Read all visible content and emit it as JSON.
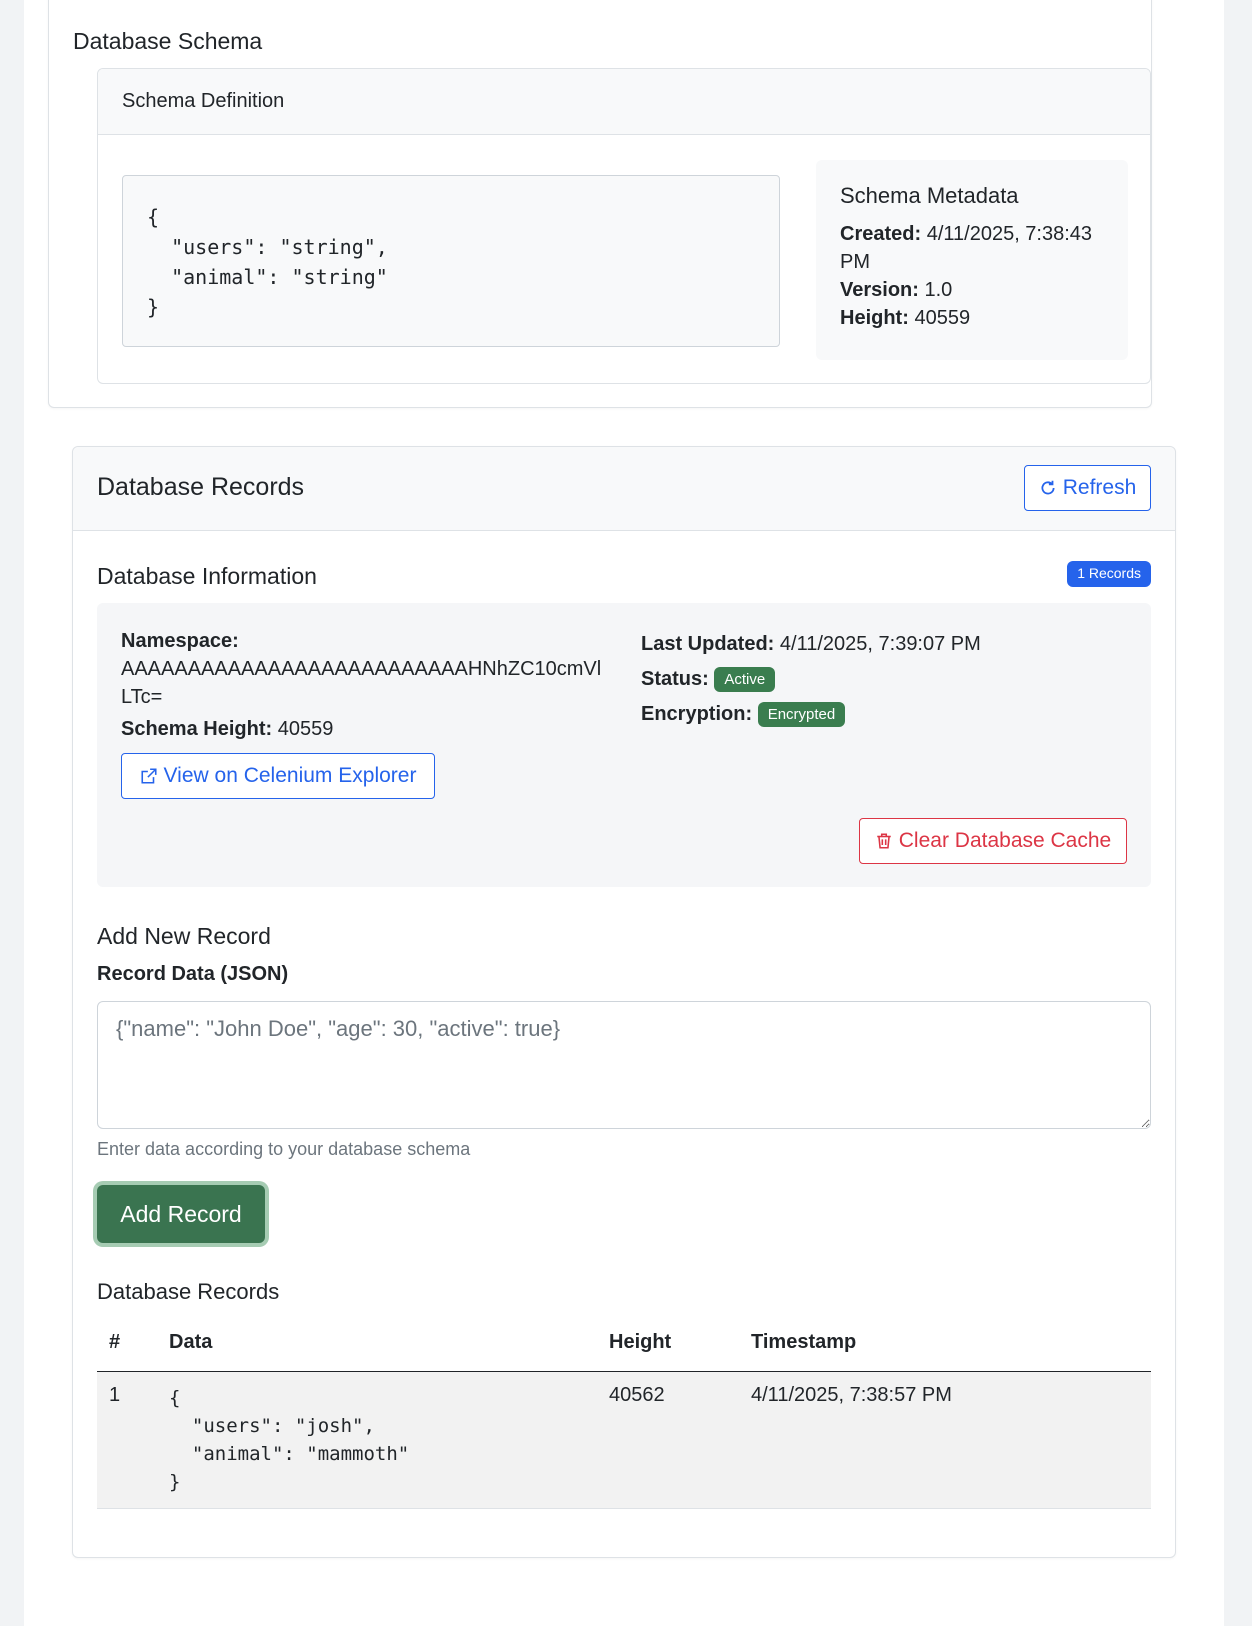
{
  "schema": {
    "section_title": "Database Schema",
    "card_header": "Schema Definition",
    "code": "{\n  \"users\": \"string\",\n  \"animal\": \"string\"\n}",
    "metadata": {
      "title": "Schema Metadata",
      "created_label": "Created:",
      "created_value": "4/11/2025, 7:38:43 PM",
      "version_label": "Version:",
      "version_value": "1.0",
      "height_label": "Height:",
      "height_value": "40559"
    }
  },
  "records": {
    "header_title": "Database Records",
    "refresh_label": "Refresh",
    "info_title": "Database Information",
    "count_badge": "1 Records",
    "namespace_label": "Namespace:",
    "namespace_value": "AAAAAAAAAAAAAAAAAAAAAAAAAAHNhZC10cmVlLTc=",
    "schema_height_label": "Schema Height:",
    "schema_height_value": "40559",
    "explorer_label": "View on Celenium Explorer",
    "last_updated_label": "Last Updated:",
    "last_updated_value": "4/11/2025, 7:39:07 PM",
    "status_label": "Status:",
    "status_value": "Active",
    "encryption_label": "Encryption:",
    "encryption_value": "Encrypted",
    "clear_cache_label": "Clear Database Cache",
    "add_title": "Add New Record",
    "field_label": "Record Data (JSON)",
    "field_placeholder": "{\"name\": \"John Doe\", \"age\": 30, \"active\": true}",
    "help_text": "Enter data according to your database schema",
    "add_button": "Add Record",
    "table_title": "Database Records",
    "columns": [
      "#",
      "Data",
      "Height",
      "Timestamp"
    ],
    "rows": [
      {
        "index": "1",
        "data": "{\n  \"users\": \"josh\",\n  \"animal\": \"mammoth\"\n}",
        "height": "40562",
        "timestamp": "4/11/2025, 7:38:57 PM"
      }
    ]
  },
  "colors": {
    "primary": "#2563eb",
    "success": "#3a7450",
    "danger": "#dc3545"
  },
  "icons": {
    "refresh": "refresh-icon",
    "external": "external-link-icon",
    "trash": "trash-icon"
  }
}
